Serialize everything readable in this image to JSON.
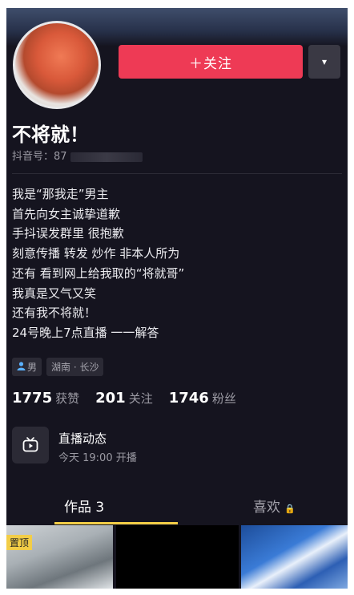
{
  "header": {
    "follow_label": "＋关注",
    "more_icon": "▾"
  },
  "profile": {
    "name": "不将就！",
    "douyin_id_label": "抖音号：87"
  },
  "bio": [
    "我是“那我走”男主",
    "首先向女主诚挚道歉",
    "手抖误发群里 很抱歉",
    "刻意传播 转发 炒作 非本人所为",
    "还有 看到网上给我取的“将就哥”",
    "我真是又气又笑",
    "还有我不将就！",
    "24号晚上7点直播 一一解答"
  ],
  "tags": {
    "gender": "男",
    "gender_icon": "person-icon",
    "location": "湖南 · 长沙"
  },
  "stats": [
    {
      "value": "1775",
      "label": "获赞"
    },
    {
      "value": "201",
      "label": "关注"
    },
    {
      "value": "1746",
      "label": "粉丝"
    }
  ],
  "live": {
    "title": "直播动态",
    "time": "今天 19:00 开播",
    "icon": "tv-play-icon"
  },
  "tabs": [
    {
      "label": "作品 3",
      "active": true
    },
    {
      "label": "喜欢",
      "active": false,
      "icon": "lock-icon"
    }
  ],
  "tab_lock": "🔒",
  "thumbnails": {
    "badge": "置顶"
  },
  "colors": {
    "background": "#15141f",
    "follow_button": "#ee3a55",
    "tab_accent": "#f2cd47"
  }
}
